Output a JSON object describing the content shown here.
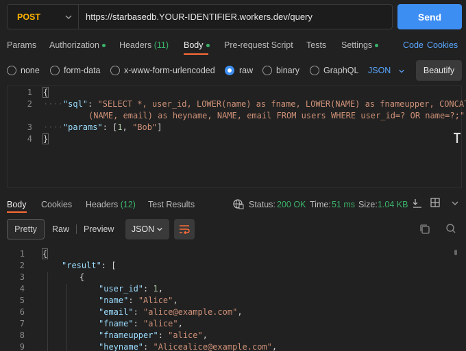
{
  "request": {
    "method": "POST",
    "url": "https://starbasedb.YOUR-IDENTIFIER.workers.dev/query",
    "send_label": "Send"
  },
  "req_tabs": {
    "params": "Params",
    "authorization": "Authorization",
    "headers": "Headers",
    "headers_count": "(11)",
    "body": "Body",
    "prerequest": "Pre-request Script",
    "tests": "Tests",
    "settings": "Settings",
    "code": "Code",
    "cookies": "Cookies"
  },
  "body_types": {
    "none": "none",
    "form_data": "form-data",
    "urlencoded": "x-www-form-urlencoded",
    "raw": "raw",
    "binary": "binary",
    "graphql": "GraphQL",
    "format": "JSON",
    "beautify": "Beautify"
  },
  "editor": {
    "line_numbers": [
      "1",
      "2",
      "",
      "3",
      "4"
    ],
    "l1": "{",
    "l2_key": "\"sql\"",
    "l2_val_a": "\"SELECT *, user_id, LOWER(name) as fname, LOWER(NAME) as fnameupper, CONCAT",
    "l2_val_b": "(NAME, email) as heyname, NAME, email FROM users WHERE user_id=? OR name=?;\"",
    "l3_key": "\"params\"",
    "l3_num": "1",
    "l3_str": "\"Bob\"",
    "l4": "}"
  },
  "resp_tabs": {
    "body": "Body",
    "cookies": "Cookies",
    "headers": "Headers",
    "headers_count": "(12)",
    "test_results": "Test Results",
    "status_label": "Status:",
    "status_value": "200 OK",
    "time_label": "Time:",
    "time_value": "51 ms",
    "size_label": "Size:",
    "size_value": "1.04 KB"
  },
  "resp_toolbar": {
    "pretty": "Pretty",
    "raw": "Raw",
    "preview": "Preview",
    "format": "JSON"
  },
  "response": {
    "line_numbers": [
      "1",
      "2",
      "3",
      "4",
      "5",
      "6",
      "7",
      "8",
      "9"
    ],
    "l1": "{",
    "l2_key": "\"result\"",
    "l3": "{",
    "l4_key": "\"user_id\"",
    "l4_val": "1",
    "l5_key": "\"name\"",
    "l5_val": "\"Alice\"",
    "l6_key": "\"email\"",
    "l6_val": "\"alice@example.com\"",
    "l7_key": "\"fname\"",
    "l7_val": "\"alice\"",
    "l8_key": "\"fnameupper\"",
    "l8_val": "\"alice\"",
    "l9_key": "\"heyname\"",
    "l9_val": "\"Alicealice@example.com\""
  },
  "colors": {
    "accent": "#ff6c37",
    "send": "#3d8ef2",
    "success": "#3bb36b",
    "method": "#ffb400"
  },
  "icons": [
    "chevron-down-icon",
    "globe-icon",
    "save-icon",
    "layout-icon",
    "copy-icon",
    "search-icon",
    "wrap-lines-icon",
    "text-cursor-icon"
  ]
}
